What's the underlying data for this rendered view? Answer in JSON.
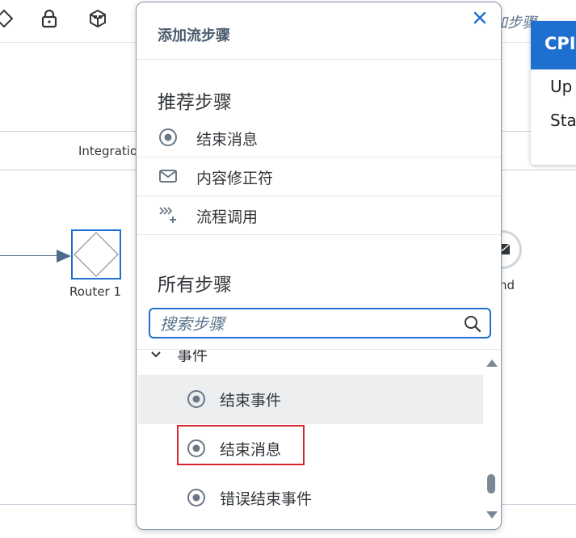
{
  "canvas": {
    "pool_label": "Integratio",
    "router_label": "Router 1",
    "end_label": "nd",
    "background_search_text": "加步骤",
    "side_card": {
      "header": "CPI",
      "lines": [
        "Up",
        "Sta"
      ]
    },
    "toolbar_icons": [
      "diamond-icon",
      "lock-icon",
      "package-icon"
    ]
  },
  "popover": {
    "title": "添加流步骤",
    "close_icon": "close-icon",
    "recommended": {
      "title": "推荐步骤",
      "items": [
        {
          "label": "结束消息",
          "icon": "end-message-icon"
        },
        {
          "label": "内容修正符",
          "icon": "mail-icon"
        },
        {
          "label": "流程调用",
          "icon": "process-call-icon"
        }
      ]
    },
    "all_steps": {
      "title": "所有步骤",
      "search_placeholder": "搜索步骤",
      "search_value": "",
      "category": "事件",
      "items": [
        {
          "label": "结束事件",
          "icon": "end-event-icon"
        },
        {
          "label": "结束消息",
          "icon": "end-message-icon"
        },
        {
          "label": "错误结束事件",
          "icon": "error-end-event-icon"
        }
      ]
    }
  },
  "colors": {
    "accent": "#1f6fd1",
    "highlight": "#d9252f",
    "text": "#32363a",
    "title": "#4a5b6f"
  }
}
